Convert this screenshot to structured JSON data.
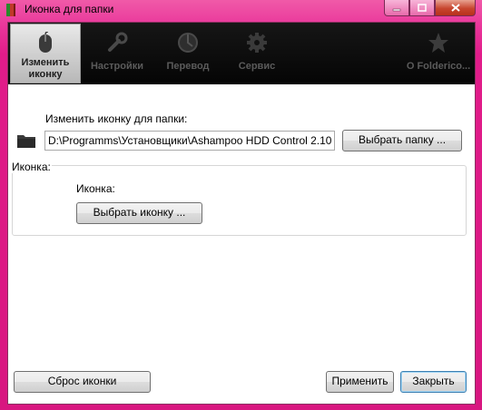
{
  "window": {
    "title": "Иконка для папки",
    "controls": [
      "minimize",
      "maximize",
      "close"
    ]
  },
  "toolbar": {
    "items": [
      {
        "label_line1": "Изменить",
        "label_line2": "иконку",
        "icon": "mouse-icon",
        "active": true
      },
      {
        "label": "Настройки",
        "icon": "wrench-icon",
        "active": false
      },
      {
        "label": "Перевод",
        "icon": "globe-icon",
        "active": false
      },
      {
        "label": "Сервис",
        "icon": "gear-icon",
        "active": false
      },
      {
        "label": "О Folderico...",
        "icon": "star-icon",
        "active": false
      }
    ]
  },
  "folder_section": {
    "label": "Изменить иконку для папки:",
    "path_value": "D:\\Programms\\Установщики\\Ashampoo HDD Control 2.10",
    "choose_button": "Выбрать папку ..."
  },
  "icon_group": {
    "legend": "Иконка:",
    "label": "Иконка:",
    "choose_button": "Выбрать иконку ..."
  },
  "footer": {
    "reset_button": "Сброс иконки",
    "apply_button": "Применить",
    "close_button": "Закрыть"
  },
  "colors": {
    "window_frame": "#e61e8c",
    "toolbar_bg": "#0b0b0b",
    "toolbar_inactive_text": "#5b5b5b",
    "close_button_accent": "#c7452e"
  }
}
